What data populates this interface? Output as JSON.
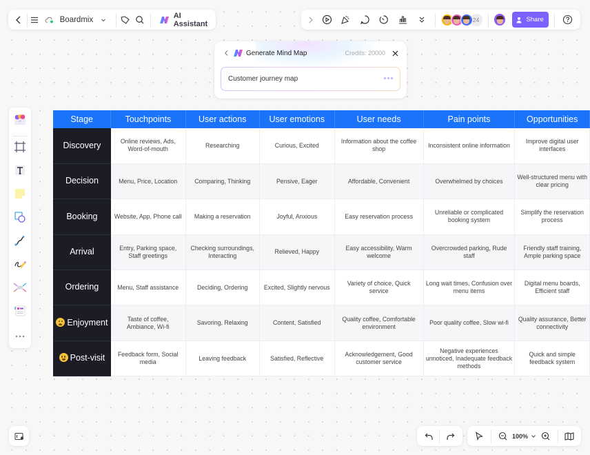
{
  "toolbar_left": {
    "back_icon": "chevron-left-icon",
    "menu_icon": "hamburger-menu-icon",
    "board_name": "Boardmix",
    "cloud_status_color": "#2ecc71",
    "tag_icon": "tag-icon",
    "search_icon": "search-icon",
    "ai_assistant_label": "AI Assistant"
  },
  "toolbar_right": {
    "collaborators_extra_count": "24",
    "share_label": "Share",
    "accent_color": "#7b61ff",
    "avatar_colors": [
      "#f6b60b",
      "#f05bc7",
      "#3b6df5",
      "#8e5cf2"
    ],
    "icons": [
      "expand-icon",
      "present-play-icon",
      "celebrate-icon",
      "comment-icon",
      "timer-icon",
      "vote-chart-icon",
      "more-chevrons-icon",
      "help-icon"
    ]
  },
  "ai_popup": {
    "title": "Generate Mind Map",
    "credits": "Credits: 20000",
    "input_value": "Customer journey map"
  },
  "tool_rail": {
    "items": [
      "templates",
      "frame",
      "text",
      "sticky-note",
      "shapes",
      "connector",
      "pen",
      "mind-map",
      "table-templates",
      "more"
    ]
  },
  "table": {
    "header_color": "#1a73f8",
    "stage_color": "#1b1c26",
    "columns": [
      "Stage",
      "Touchpoints",
      "User actions",
      "User emotions",
      "User needs",
      "Pain points",
      "Opportunities"
    ],
    "rows": [
      {
        "stage": "Discovery",
        "emoji": "",
        "cells": [
          "Online reviews, Ads, Word-of-mouth",
          "Researching",
          "Curious, Excited",
          "Information about the coffee shop",
          "Inconsistent online information",
          "Improve digital user interfaces"
        ]
      },
      {
        "stage": "Decision",
        "emoji": "",
        "cells": [
          "Menu, Price, Location",
          "Comparing, Thinking",
          "Pensive, Eager",
          "Affordable, Convenient",
          "Overwhelmed by choices",
          "Well-structured menu with clear pricing"
        ]
      },
      {
        "stage": "Booking",
        "emoji": "",
        "cells": [
          "Website, App, Phone call",
          "Making a reservation",
          "Joyful, Anxious",
          "Easy reservation process",
          "Unreliable or complicated booking system",
          "Simplify the reservation process"
        ]
      },
      {
        "stage": "Arrival",
        "emoji": "",
        "cells": [
          "Entry, Parking space, Staff greetings",
          "Checking surroundings, Interacting",
          "Relieved, Happy",
          "Easy accessibility, Warm welcome",
          "Overcrowded parking, Rude staff",
          "Friendly staff training, Ample parking space"
        ]
      },
      {
        "stage": "Ordering",
        "emoji": "",
        "cells": [
          "Menu, Staff assistance",
          "Deciding, Ordering",
          "Excited, Slightly nervous",
          "Variety of choice, Quick service",
          "Long wait times, Confusion over menu items",
          "Digital menu boards, Efficient staff"
        ]
      },
      {
        "stage": "Enjoyment",
        "emoji": "worried-face",
        "cells": [
          "Taste of coffee, Ambiance, Wi-fi",
          "Savoring, Relaxing",
          "Content, Satisfied",
          "Quality coffee, Comfortable environment",
          "Poor quality coffee, Slow wi-fi",
          "Quality assurance, Better connectivity"
        ]
      },
      {
        "stage": "Post-visit",
        "emoji": "smiling-face",
        "cells": [
          "Feedback form, Social media",
          "Leaving feedback",
          "Satisfied, Reflective",
          "Acknowledgement, Good customer service",
          "Negative experiences unnoticed, Inadequate feedback methods",
          "Quick and simple feedback system"
        ]
      }
    ]
  },
  "bottom_bar": {
    "zoom_level": "100%"
  }
}
